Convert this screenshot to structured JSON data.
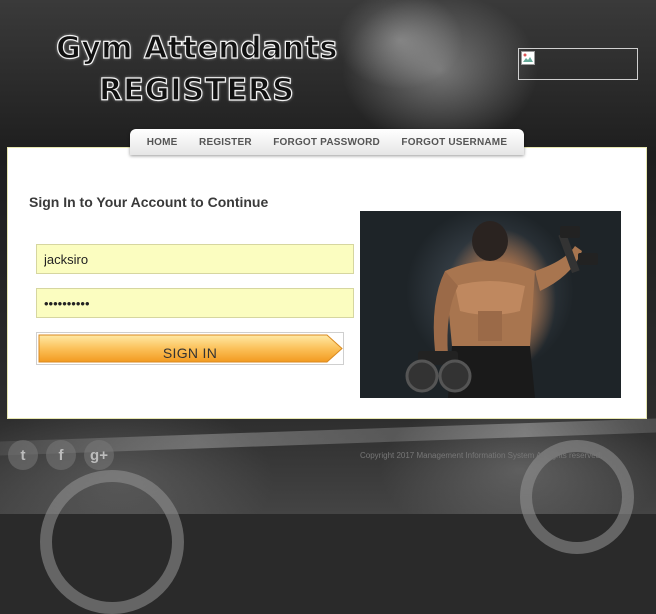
{
  "header": {
    "title_line1": "Gym Attendants",
    "title_line2": "REGISTERS"
  },
  "nav": {
    "items": [
      {
        "label": "HOME"
      },
      {
        "label": "REGISTER"
      },
      {
        "label": "FORGOT PASSWORD"
      },
      {
        "label": "FORGOT USERNAME"
      }
    ]
  },
  "login": {
    "heading": "Sign In to Your Account to Continue",
    "username_value": "jacksiro",
    "password_value": "••••••••••",
    "signin_label": "SIGN IN"
  },
  "footer": {
    "social": [
      {
        "icon": "twitter-icon",
        "glyph": "t"
      },
      {
        "icon": "facebook-icon",
        "glyph": "f"
      },
      {
        "icon": "google-plus-icon",
        "glyph": "g+"
      }
    ],
    "copyright": "Copyright 2017  Management Information System All rights reserved."
  },
  "colors": {
    "input_bg": "#fbfdc0",
    "button_orange": "#f7a12b",
    "nav_text": "#555555"
  }
}
